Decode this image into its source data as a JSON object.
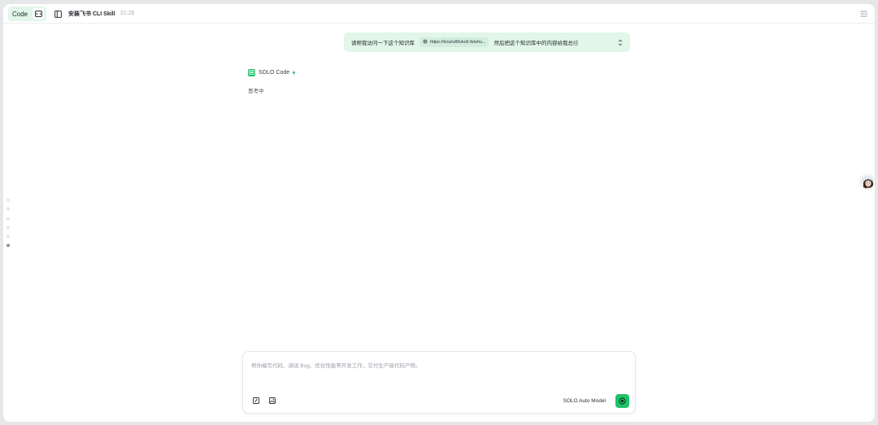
{
  "header": {
    "mode_label": "Code",
    "mode_icon": "code-mode-icon",
    "sidebar_icon": "sidebar-toggle-icon",
    "title": "安装飞书 CLI Skill",
    "time": "21:26",
    "panel_icon": "panel-toggle-icon"
  },
  "user_message": {
    "text_before": "请帮我访问一下这个知识库",
    "url": "https://lcnziv86vkx6.feishu...",
    "url_icon": "globe-icon",
    "text_after": "然后把这个知识库中的内容给我总结",
    "expand_icon": "expand-collapse-icon"
  },
  "assistant": {
    "name": "SOLO Code",
    "logo_icon": "solo-logo-icon",
    "status_icon": "lightning-icon",
    "status_text": "思考中"
  },
  "composer": {
    "placeholder": "帮你编写代码、调试 Bug、优化性能等开发工作，交付生产级代码产物。",
    "model_label": "SOLO Auto Model",
    "tools": [
      "slash-command-icon",
      "image-upload-icon"
    ],
    "send_icon": "send-icon"
  },
  "nav_dots": {
    "count": 6,
    "active_index": 5
  },
  "colors": {
    "accent": "#20c167",
    "user_bubble": "#e2f6ea",
    "background": "#e6e7e9"
  }
}
